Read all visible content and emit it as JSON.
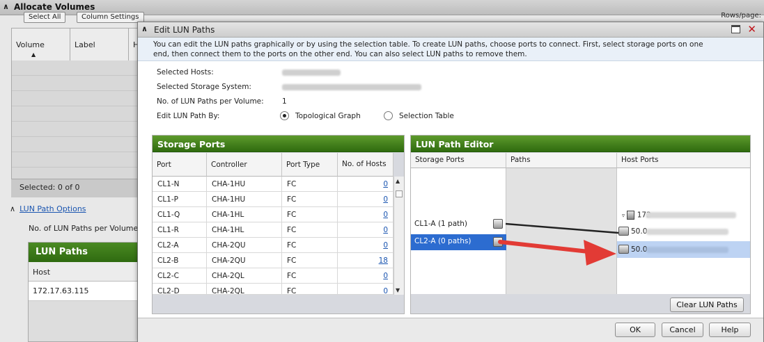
{
  "background": {
    "title": "Allocate Volumes",
    "select_all": "Select All",
    "column_settings": "Column Settings",
    "rows_per_page": "Rows/page:",
    "columns": [
      "Volume",
      "Label",
      "H"
    ],
    "selected": "Selected: 0 of 0",
    "lun_path_options": "LUN Path Options",
    "no_lun_paths": "No. of LUN Paths per Volume",
    "lun_paths_title": "LUN Paths",
    "lun_paths_col": "Host",
    "lun_paths_row": "172.17.63.115"
  },
  "dialog": {
    "title": "Edit LUN Paths",
    "description_line1": "You can edit the LUN paths graphically or by using the selection table. To create LUN paths, choose ports to connect. First, select storage ports on one",
    "description_line2": "end, then connect them to the ports on the other end. You can also select LUN paths to remove them.",
    "selected_hosts_label": "Selected Hosts:",
    "selected_storage_label": "Selected Storage System:",
    "paths_per_volume_label": "No. of LUN Paths per Volume:",
    "paths_per_volume_value": "1",
    "edit_by_label": "Edit LUN Path By:",
    "opt_graph": "Topological Graph",
    "opt_table": "Selection Table"
  },
  "storage_ports": {
    "title": "Storage Ports",
    "headers": [
      "Port",
      "Controller",
      "Port Type",
      "No. of Hosts"
    ],
    "rows": [
      {
        "port": "CL1-N",
        "controller": "CHA-1HU",
        "type": "FC",
        "hosts": "0"
      },
      {
        "port": "CL1-P",
        "controller": "CHA-1HU",
        "type": "FC",
        "hosts": "0"
      },
      {
        "port": "CL1-Q",
        "controller": "CHA-1HL",
        "type": "FC",
        "hosts": "0"
      },
      {
        "port": "CL1-R",
        "controller": "CHA-1HL",
        "type": "FC",
        "hosts": "0"
      },
      {
        "port": "CL2-A",
        "controller": "CHA-2QU",
        "type": "FC",
        "hosts": "0"
      },
      {
        "port": "CL2-B",
        "controller": "CHA-2QU",
        "type": "FC",
        "hosts": "18"
      },
      {
        "port": "CL2-C",
        "controller": "CHA-2QL",
        "type": "FC",
        "hosts": "0"
      },
      {
        "port": "CL2-D",
        "controller": "CHA-2QL",
        "type": "FC",
        "hosts": "0"
      }
    ]
  },
  "lun_editor": {
    "title": "LUN Path Editor",
    "col_storage": "Storage Ports",
    "col_paths": "Paths",
    "col_host": "Host Ports",
    "storage_port_1": "CL1-A (1 path)",
    "storage_port_2": "CL2-A (0 paths)",
    "host_group": "172",
    "host_port_1": "50.0",
    "host_port_2": "50.0",
    "clear_button": "Clear LUN Paths"
  },
  "footer": {
    "ok": "OK",
    "cancel": "Cancel",
    "help": "Help"
  },
  "colors": {
    "green": "#3f7d1a",
    "selection": "#2c6cd0",
    "arrow": "#e23b35"
  }
}
